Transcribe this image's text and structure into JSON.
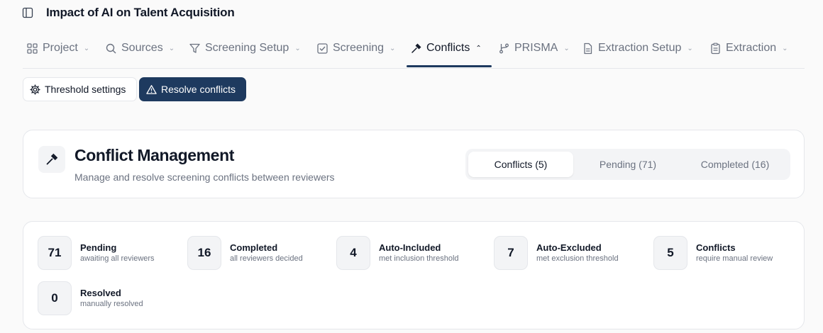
{
  "header": {
    "title": "Impact of AI on Talent Acquisition"
  },
  "nav": {
    "items": [
      {
        "label": "Project",
        "icon": "grid-icon",
        "active": false
      },
      {
        "label": "Sources",
        "icon": "search-icon",
        "active": false
      },
      {
        "label": "Screening Setup",
        "icon": "filter-icon",
        "active": false
      },
      {
        "label": "Screening",
        "icon": "checkbox-icon",
        "active": false
      },
      {
        "label": "Conflicts",
        "icon": "gavel-icon",
        "active": true
      },
      {
        "label": "PRISMA",
        "icon": "branch-icon",
        "active": false
      },
      {
        "label": "Extraction Setup",
        "icon": "document-icon",
        "active": false
      },
      {
        "label": "Extraction",
        "icon": "clipboard-icon",
        "active": false
      }
    ]
  },
  "toolbar": {
    "threshold_label": "Threshold settings",
    "resolve_label": "Resolve conflicts"
  },
  "conflict_card": {
    "title": "Conflict Management",
    "subtitle": "Manage and resolve screening conflicts between reviewers",
    "tabs": [
      {
        "label": "Conflicts (5)",
        "active": true
      },
      {
        "label": "Pending (71)",
        "active": false
      },
      {
        "label": "Completed (16)",
        "active": false
      }
    ]
  },
  "stats": [
    {
      "value": "71",
      "label": "Pending",
      "desc": "awaiting all reviewers"
    },
    {
      "value": "16",
      "label": "Completed",
      "desc": "all reviewers decided"
    },
    {
      "value": "4",
      "label": "Auto-Included",
      "desc": "met inclusion threshold"
    },
    {
      "value": "7",
      "label": "Auto-Excluded",
      "desc": "met exclusion threshold"
    },
    {
      "value": "5",
      "label": "Conflicts",
      "desc": "require manual review"
    },
    {
      "value": "0",
      "label": "Resolved",
      "desc": "manually resolved"
    }
  ],
  "colors": {
    "accent": "#1e3a5f",
    "muted_text": "#6b7280",
    "border": "#e5e7eb"
  }
}
